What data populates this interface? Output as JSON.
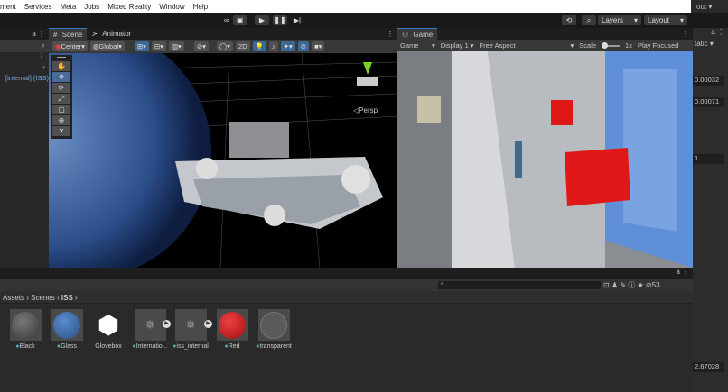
{
  "menu": [
    "ment",
    "Services",
    "Meta",
    "Jobs",
    "Mixed Reality",
    "Window",
    "Help"
  ],
  "corner_label": "out",
  "toolbar": {
    "layers": "Layers",
    "layout": "Layout"
  },
  "hierarchy": {
    "item": "(ISS) [internal]"
  },
  "scene": {
    "tab": "Scene",
    "tab2": "Animator",
    "pivot": "Center",
    "space": "Global",
    "mode2d": "2D",
    "persp": "Persp",
    "tools": [
      "✋",
      "✥",
      "⟳",
      "⤢",
      "▢",
      "⊕",
      "✕"
    ]
  },
  "game": {
    "tab": "Game",
    "display_mode": "Game",
    "display": "Display 1",
    "aspect": "Free Aspect",
    "scale_label": "Scale",
    "scale_value": "1x",
    "play_focused": "Play Focused"
  },
  "inspector": {
    "static": "tatic",
    "values": [
      "0.00032",
      "0.00071",
      "1",
      "2.67028"
    ]
  },
  "project": {
    "breadcrumb": [
      "Assets",
      "Scenes",
      "ISS"
    ],
    "hidden_count": "53",
    "assets": [
      {
        "name": "Black",
        "color": "#555"
      },
      {
        "name": "Glass",
        "color": "#3c6ea8"
      },
      {
        "name": "Glovebox",
        "color": ""
      },
      {
        "name": "Internatio...",
        "color": ""
      },
      {
        "name": "iss_internal",
        "color": ""
      },
      {
        "name": "Red",
        "color": "#d02020"
      },
      {
        "name": "transparent",
        "color": "#5a5a5a"
      }
    ]
  }
}
